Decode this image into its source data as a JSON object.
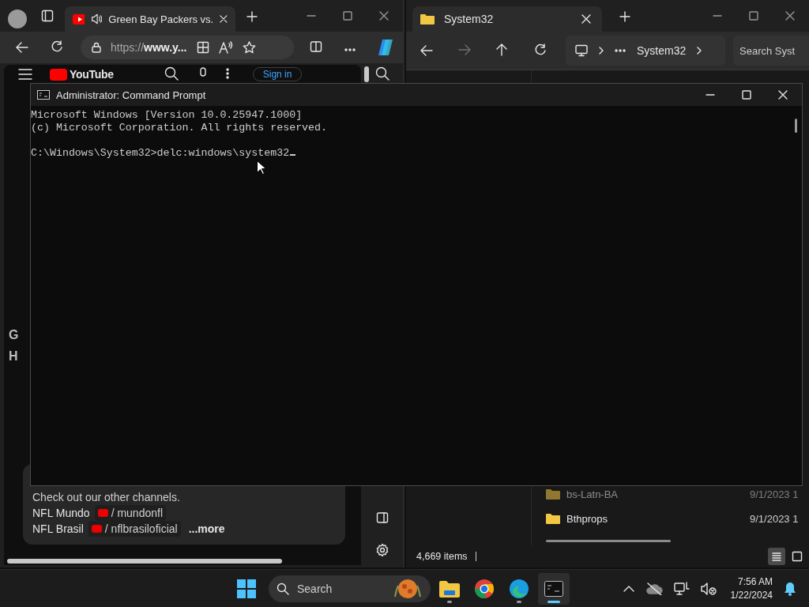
{
  "browser": {
    "tab": {
      "title": "Green Bay Packers vs.",
      "selected": true
    },
    "address": "https://**www.y...**",
    "page": {
      "logo": "YouTube",
      "sign_in": "Sign in",
      "title_fragments": [
        "G",
        "H"
      ],
      "description": "Check out our other channels.",
      "channel_links": [
        {
          "name": "NFL Mundo",
          "handle": "/ mundonfl"
        },
        {
          "name": "NFL Brasil",
          "handle": "/ nflbrasiloficial"
        }
      ],
      "more": "...more"
    }
  },
  "explorer": {
    "tab": {
      "title": "System32",
      "selected": true
    },
    "breadcrumb": "System32",
    "search": {
      "placeholder": "Search Syst"
    },
    "files": [
      {
        "name": "bs-Latn-BA",
        "date": "9/1/2023 1",
        "hidden": true
      },
      {
        "name": "Bthprops",
        "date": "9/1/2023 1",
        "hidden": false
      }
    ],
    "status": "4,669 items",
    "views": [
      {
        "kind": "details",
        "selected": true
      },
      {
        "kind": "tiles",
        "selected": false
      }
    ]
  },
  "cmd": {
    "title": "Administrator: Command Prompt",
    "banner": [
      "Microsoft Windows [Version 10.0.25947.1000]",
      "(c) Microsoft Corporation. All rights reserved."
    ],
    "prompt": "C:\\Windows\\System32>delc:windows\\system32"
  },
  "taskbar": {
    "search": {
      "placeholder": "Search"
    },
    "apps": [
      {
        "kind": "files",
        "running": true,
        "selected": false
      },
      {
        "kind": "chrome",
        "running": false,
        "selected": false
      },
      {
        "kind": "edge",
        "running": true,
        "selected": false
      },
      {
        "kind": "terminal",
        "running": true,
        "selected": true
      }
    ],
    "time": "7:56 AM",
    "date": "1/22/2024"
  }
}
